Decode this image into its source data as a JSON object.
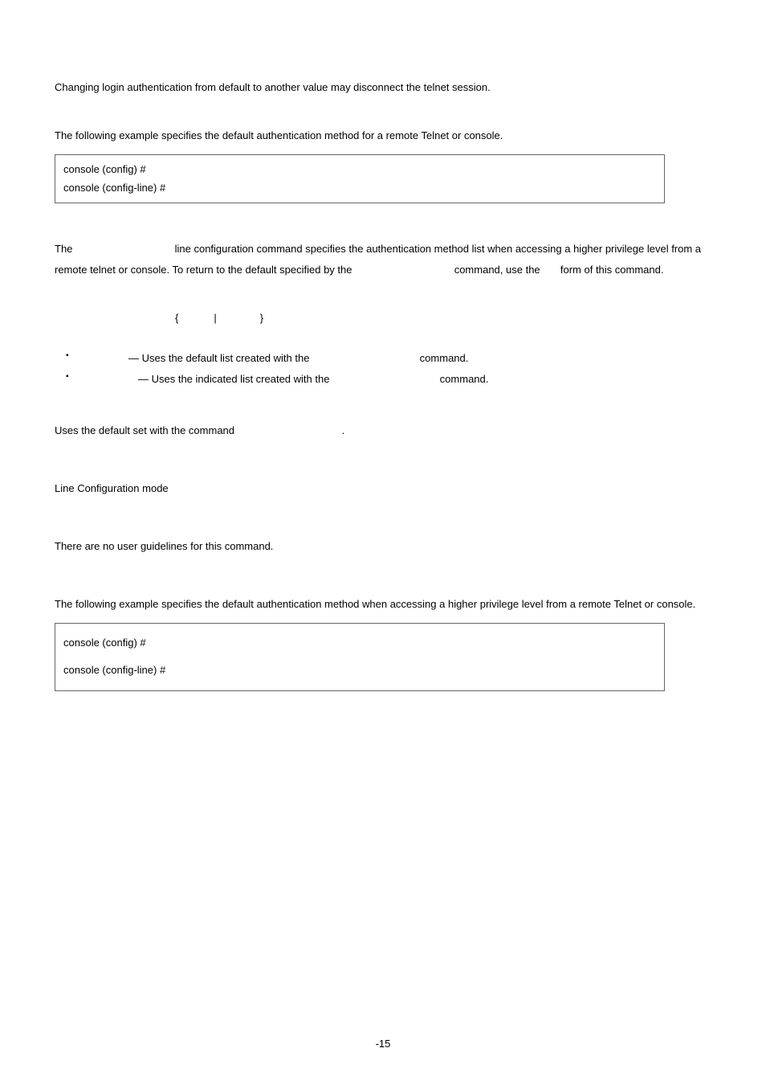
{
  "para1": "Changing login authentication from default to another value may disconnect the telnet session.",
  "para2": "The following example specifies the default authentication method for a remote Telnet or console.",
  "code1": {
    "line1": "console (config) #",
    "line2": "console (config-line) #"
  },
  "desc": {
    "seg1": "The ",
    "seg2": " line configuration command specifies the authentication method list when accessing a higher privilege level from a remote telnet or console. To return to the default specified by the ",
    "seg3": " command, use the ",
    "seg4": " form of this command."
  },
  "syntax": {
    "leftbrace": "{",
    "pipe": "|",
    "rightbrace": "}"
  },
  "bullets": {
    "b1": {
      "seg1": "— Uses the default list created with the ",
      "seg2": " command."
    },
    "b2": {
      "seg1": "— Uses the indicated list created with the ",
      "seg2": " command."
    }
  },
  "default_line": {
    "seg1": "Uses the default set with the command ",
    "seg2": "."
  },
  "mode": "Line Configuration mode",
  "guidelines": "There are no user guidelines for this command.",
  "example2": "The following example specifies the default authentication method when accessing a higher privilege level from a remote Telnet or console.",
  "code2": {
    "line1": "console (config) #",
    "line2": "console (config-line) #"
  },
  "pagenum": "-15"
}
